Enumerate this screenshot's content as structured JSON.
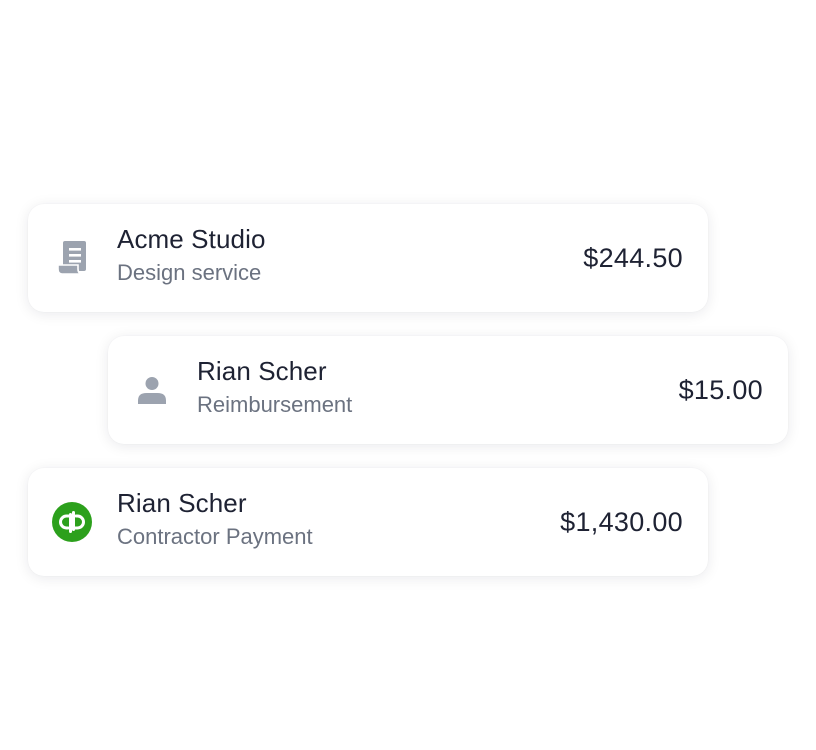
{
  "transactions": [
    {
      "name": "Acme Studio",
      "description": "Design service",
      "amount": "$244.50",
      "icon": "receipt-icon",
      "icon_color": "#9ca3af"
    },
    {
      "name": "Rian Scher",
      "description": "Reimbursement",
      "amount": "$15.00",
      "icon": "person-icon",
      "icon_color": "#9ca3af"
    },
    {
      "name": "Rian Scher",
      "description": "Contractor Payment",
      "amount": "$1,430.00",
      "icon": "quickbooks-logo-icon",
      "icon_color": "#2ca01c"
    }
  ]
}
